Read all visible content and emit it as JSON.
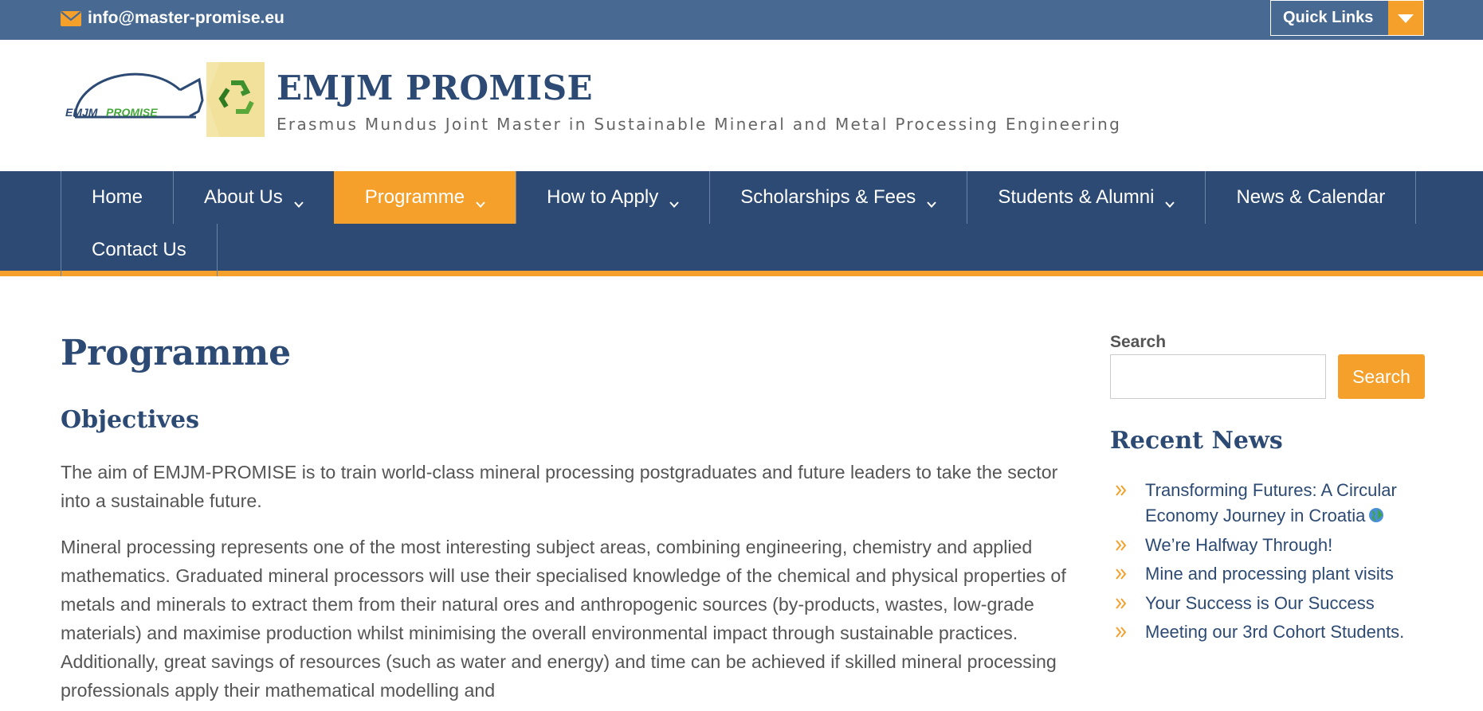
{
  "topbar": {
    "email": "info@master-promise.eu",
    "quick_links_label": "Quick Links",
    "icons": [
      "envelope-icon",
      "caret-down-icon"
    ]
  },
  "header": {
    "logo_text": "EMJM PROMISE",
    "site_title": "EMJM PROMISE",
    "site_description": "Erasmus Mundus Joint Master in Sustainable Mineral and Metal Processing Engineering"
  },
  "nav": {
    "items": [
      {
        "label": "Home",
        "has_dropdown": false,
        "active": false
      },
      {
        "label": "About Us",
        "has_dropdown": true,
        "active": false
      },
      {
        "label": "Programme",
        "has_dropdown": true,
        "active": true
      },
      {
        "label": "How to Apply",
        "has_dropdown": true,
        "active": false
      },
      {
        "label": "Scholarships & Fees",
        "has_dropdown": true,
        "active": false
      },
      {
        "label": "Students & Alumni",
        "has_dropdown": true,
        "active": false
      },
      {
        "label": "News & Calendar",
        "has_dropdown": false,
        "active": false
      },
      {
        "label": "Contact Us",
        "has_dropdown": false,
        "active": false
      }
    ]
  },
  "main": {
    "page_title": "Programme",
    "section_title": "Objectives",
    "paragraphs": [
      "The aim of EMJM-PROMISE is to train world-class mineral processing postgraduates and future leaders to take the sector into a sustainable future.",
      "Mineral processing represents one of the most interesting subject areas, combining engineering, chemistry and applied mathematics. Graduated mineral processors will use their specialised knowledge of the chemical and physical properties of metals and minerals to extract them from their natural ores and anthropogenic sources (by-products, wastes, low-grade materials) and maximise production whilst minimising the overall environmental impact through sustainable practices. Additionally, great savings of resources (such as water and energy) and time can be achieved if skilled mineral processing professionals apply their mathematical modelling and"
    ]
  },
  "sidebar": {
    "search_label": "Search",
    "search_value": "",
    "search_button": "Search",
    "recent_title": "Recent News",
    "news": [
      {
        "title": "Transforming Futures: A Circular Economy Journey in Croatia",
        "emoji": "globe-icon"
      },
      {
        "title": "We’re Halfway Through!"
      },
      {
        "title": "Mine and processing plant visits"
      },
      {
        "title": "Your Success is Our Success"
      },
      {
        "title": "Meeting our 3rd Cohort Students."
      }
    ]
  },
  "colors": {
    "topbar": "#486a92",
    "nav": "#2c4a73",
    "accent": "#f4a02b",
    "heading": "#2c4a73",
    "body_text": "#555555"
  }
}
